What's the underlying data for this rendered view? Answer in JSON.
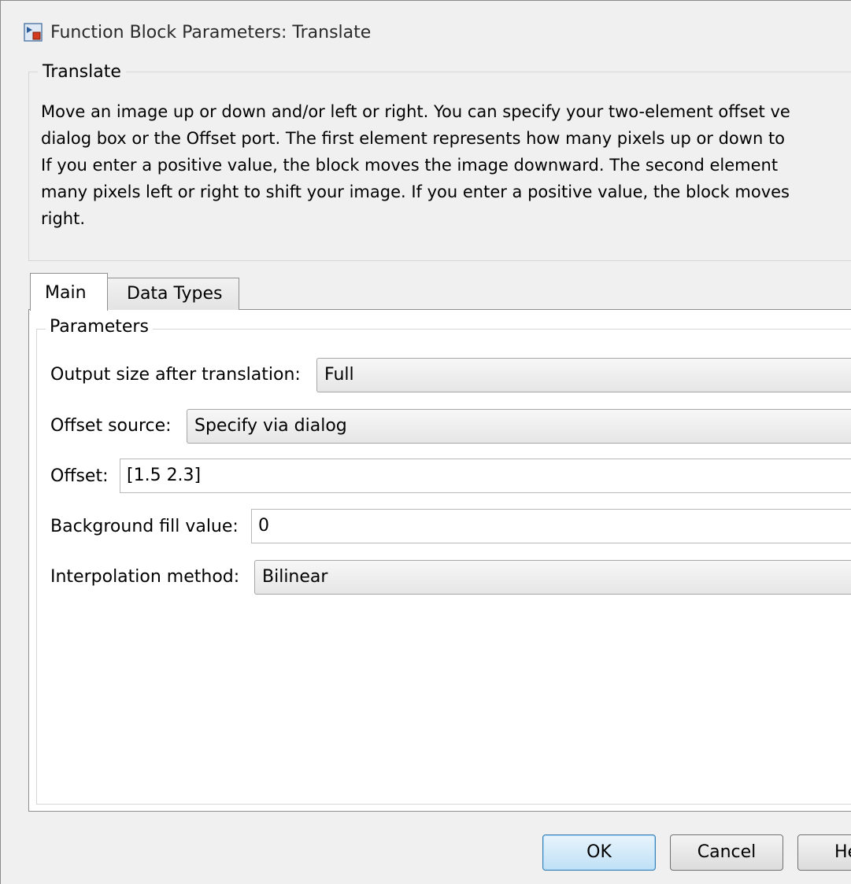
{
  "window": {
    "title": "Function Block Parameters: Translate",
    "icon": "simulink-block-icon"
  },
  "description": {
    "group_title": "Translate",
    "lines": [
      "Move an image up or down and/or left or right. You can specify your two-element offset ve",
      "dialog box or the Offset port. The first element represents how many pixels up or down to",
      "If you enter a positive value, the block moves the image downward.  The second element",
      "many pixels left or right to shift your image. If you enter a positive value, the block moves",
      "right."
    ]
  },
  "tabs": [
    {
      "label": "Main",
      "selected": true
    },
    {
      "label": "Data Types",
      "selected": false
    }
  ],
  "parameters": {
    "group_title": "Parameters",
    "output_size_label": "Output size after translation:",
    "output_size_value": "Full",
    "offset_source_label": "Offset source:",
    "offset_source_value": "Specify via dialog",
    "offset_label": "Offset:",
    "offset_value": "[1.5  2.3]",
    "bg_fill_label": "Background fill value:",
    "bg_fill_value": "0",
    "interp_label": "Interpolation method:",
    "interp_value": "Bilinear"
  },
  "buttons": {
    "ok": "OK",
    "cancel": "Cancel",
    "help": "He"
  }
}
